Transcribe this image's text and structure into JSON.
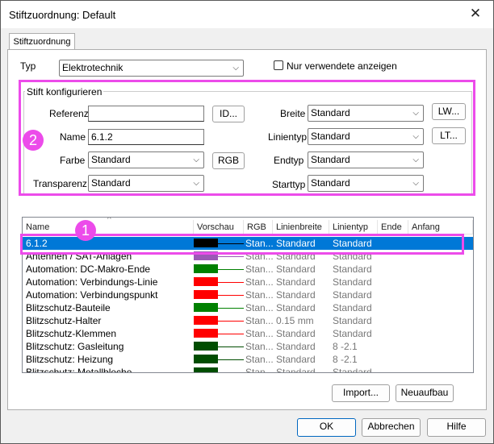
{
  "window": {
    "title": "Stiftzuordnung: Default"
  },
  "tab": {
    "label": "Stiftzuordnung"
  },
  "typ": {
    "label": "Typ",
    "value": "Elektrotechnik"
  },
  "only_used": {
    "label": "Nur verwendete anzeigen",
    "checked": false
  },
  "group": {
    "title": "Stift konfigurieren"
  },
  "fields": {
    "referenz": {
      "label": "Referenz",
      "value": ""
    },
    "name": {
      "label": "Name",
      "value": "6.1.2"
    },
    "farbe": {
      "label": "Farbe",
      "value": "Standard"
    },
    "transparenz": {
      "label": "Transparenz",
      "value": "Standard"
    },
    "breite": {
      "label": "Breite",
      "value": "Standard"
    },
    "linientyp": {
      "label": "Linientyp",
      "value": "Standard"
    },
    "endtyp": {
      "label": "Endtyp",
      "value": "Standard"
    },
    "starttyp": {
      "label": "Starttyp",
      "value": "Standard"
    }
  },
  "buttons": {
    "id": "ID...",
    "rgb": "RGB",
    "lw": "LW...",
    "lt": "LT...",
    "import": "Import...",
    "rebuild": "Neuaufbau",
    "ok": "OK",
    "cancel": "Abbrechen",
    "help": "Hilfe"
  },
  "badges": {
    "one": "1",
    "two": "2"
  },
  "columns": [
    "Name",
    "Vorschau",
    "RGB",
    "Linienbreite",
    "Linientyp",
    "Ende",
    "Anfang"
  ],
  "rows": [
    {
      "name": "6.1.2",
      "color": "#000000",
      "rgb": "Stan...",
      "width": "Standard",
      "linetype": "Standard",
      "selected": true
    },
    {
      "name": "Antennen / SAT-Anlagen",
      "color": "#9b59b6",
      "rgb": "Stan...",
      "width": "Standard",
      "linetype": "Standard",
      "selected": false
    },
    {
      "name": "Automation: DC-Makro-Ende",
      "color": "#008000",
      "rgb": "Stan...",
      "width": "Standard",
      "linetype": "Standard",
      "selected": false
    },
    {
      "name": "Automation: Verbindungs-Linie",
      "color": "#ff0000",
      "rgb": "Stan...",
      "width": "Standard",
      "linetype": "Standard",
      "selected": false
    },
    {
      "name": "Automation: Verbindungspunkt",
      "color": "#ff0000",
      "rgb": "Stan...",
      "width": "Standard",
      "linetype": "Standard",
      "selected": false
    },
    {
      "name": "Blitzschutz-Bauteile",
      "color": "#008000",
      "rgb": "Stan...",
      "width": "Standard",
      "linetype": "Standard",
      "selected": false
    },
    {
      "name": "Blitzschutz-Halter",
      "color": "#ff0000",
      "rgb": "Stan...",
      "width": "0.15 mm",
      "linetype": "Standard",
      "selected": false
    },
    {
      "name": "Blitzschutz-Klemmen",
      "color": "#ff0000",
      "rgb": "Stan...",
      "width": "Standard",
      "linetype": "Standard",
      "selected": false
    },
    {
      "name": "Blitzschutz: Gasleitung",
      "color": "#004d00",
      "rgb": "Stan...",
      "width": "Standard",
      "linetype": "8 -2.1",
      "selected": false
    },
    {
      "name": "Blitzschutz: Heizung",
      "color": "#004d00",
      "rgb": "Stan...",
      "width": "Standard",
      "linetype": "8 -2.1",
      "selected": false
    },
    {
      "name": "Blitzschutz: Metallbleche",
      "color": "#004d00",
      "rgb": "Stan...",
      "width": "Standard",
      "linetype": "Standard",
      "selected": false
    }
  ]
}
